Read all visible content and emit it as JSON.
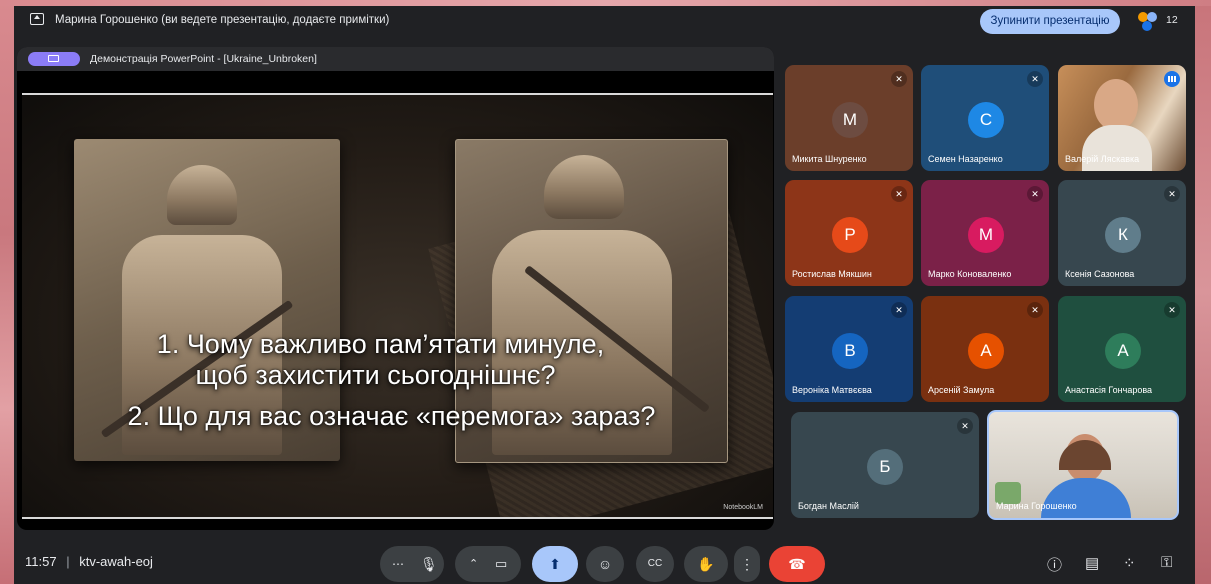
{
  "topbar": {
    "presenting_text": "Марина Горошенко (ви ведете презентацію, додаєте примітки)",
    "stop_button": "Зупинити презентацію",
    "participant_count": "12"
  },
  "presentation": {
    "title": "Демонстрація PowerPoint - [Ukraine_Unbroken]",
    "slide_line1": "1. Чому важливо пам’ятати минуле,",
    "slide_line2": "щоб захистити сьогоднішнє?",
    "slide_line3": "2. Що для вас означає «перемога» зараз?",
    "watermark": "NotebookLM"
  },
  "participants": [
    {
      "initial": "М",
      "name": "Микита Шнуренко",
      "avatar_color": "#6d4c41",
      "tile_color": "#6b3e2a",
      "mic": "muted"
    },
    {
      "initial": "С",
      "name": "Семен Назаренко",
      "avatar_color": "#1e88e5",
      "tile_color": "#1f4e79",
      "mic": "muted"
    },
    {
      "name": "Валерій Ляскавка",
      "mic": "speaking"
    },
    {
      "initial": "Р",
      "name": "Ростислав Мякшин",
      "avatar_color": "#e64a19",
      "tile_color": "#8d3518",
      "mic": "muted"
    },
    {
      "initial": "М",
      "name": "Марко Коноваленко",
      "avatar_color": "#d81b60",
      "tile_color": "#7b2148",
      "mic": "muted"
    },
    {
      "initial": "К",
      "name": "Ксенія Сазонова",
      "avatar_color": "#607d8b",
      "tile_color": "#37474f",
      "mic": "muted"
    },
    {
      "initial": "В",
      "name": "Вероніка Матвєєва",
      "avatar_color": "#1565c0",
      "tile_color": "#143d73",
      "mic": "muted"
    },
    {
      "initial": "А",
      "name": "Арсеній Замула",
      "avatar_color": "#e65100",
      "tile_color": "#7a3010",
      "mic": "muted"
    },
    {
      "initial": "А",
      "name": "Анастасія Гончарова",
      "avatar_color": "#2e7d5b",
      "tile_color": "#1f4f3f",
      "mic": "muted"
    },
    {
      "initial": "Б",
      "name": "Богдан Маслій",
      "avatar_color": "#546e7a",
      "tile_color": "#37474f",
      "mic": "muted"
    },
    {
      "name": "Марина Горошенко",
      "mic": "none"
    }
  ],
  "bottombar": {
    "time": "11:57",
    "meeting_code": "ktv-awah-eoj",
    "separator": "|"
  },
  "icons": {
    "mic": "mic-icon",
    "mic_off": "mic-off-icon",
    "camera": "camera-icon",
    "present": "present-icon",
    "emoji": "emoji-icon",
    "captions": "captions-icon",
    "hand": "raise-hand-icon",
    "more": "more-icon",
    "end_call": "end-call-icon",
    "info": "info-icon",
    "chat": "chat-icon",
    "activities": "activities-icon",
    "host_controls": "host-controls-icon"
  },
  "colors": {
    "accent": "#a8c7fa",
    "end_call": "#ea4335",
    "background": "#202124"
  }
}
